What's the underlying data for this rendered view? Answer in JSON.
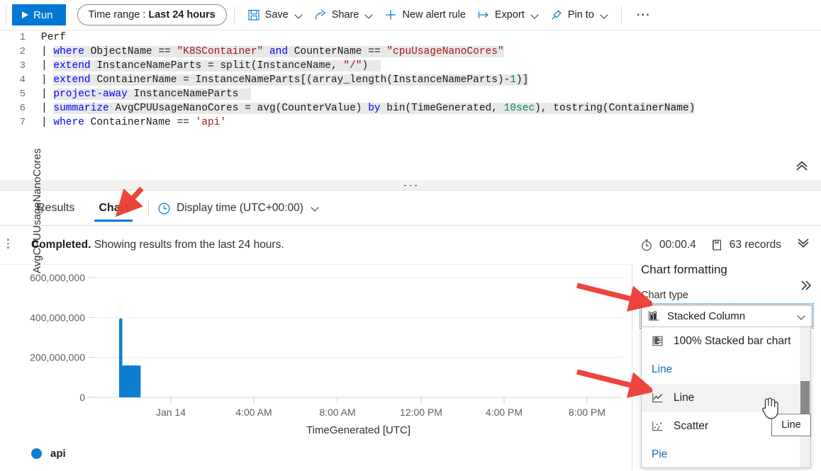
{
  "toolbar": {
    "run_label": "Run",
    "time_range_label": "Time range :",
    "time_range_value": "Last 24 hours",
    "save_label": "Save",
    "share_label": "Share",
    "new_alert_label": "New alert rule",
    "export_label": "Export",
    "pin_label": "Pin to",
    "more_label": "⋯",
    "accent": "#0078d4"
  },
  "editor": {
    "lines": [
      {
        "n": "1",
        "text": "Perf"
      },
      {
        "n": "2",
        "text": "| where ObjectName == \"K8SContainer\" and CounterName == \"cpuUsageNanoCores\""
      },
      {
        "n": "3",
        "text": "| extend InstanceNameParts = split(InstanceName, \"/\")"
      },
      {
        "n": "4",
        "text": "| extend ContainerName = InstanceNameParts[(array_length(InstanceNameParts)-1)]"
      },
      {
        "n": "5",
        "text": "| project-away InstanceNameParts"
      },
      {
        "n": "6",
        "text": "| summarize AvgCPUUsageNanoCores = avg(CounterValue) by bin(TimeGenerated, 10sec), tostring(ContainerName)"
      },
      {
        "n": "7",
        "text": "| where ContainerName == 'api'"
      }
    ],
    "collapse_icon": "chevron-double-up-icon"
  },
  "tabs": {
    "results_label": "Results",
    "chart_label": "Chart",
    "active": "Chart",
    "display_time_label": "Display time (UTC+00:00)"
  },
  "status": {
    "state": "Completed.",
    "message": " Showing results from the last 24 hours.",
    "duration": "00:00.4",
    "records": "63 records",
    "expand_icon": "chevron-double-down-icon"
  },
  "chart_data": {
    "type": "bar",
    "title": "",
    "xlabel": "TimeGenerated [UTC]",
    "ylabel": "AvgCPUUsageNanoCores",
    "ylim": [
      0,
      600000000
    ],
    "yticks": [
      "0",
      "200,000,000",
      "400,000,000",
      "600,000,000"
    ],
    "ytick_values": [
      0,
      200000000,
      400000000,
      600000000
    ],
    "xticks": [
      "Jan 14",
      "4:00 AM",
      "8:00 AM",
      "12:00 PM",
      "4:00 PM",
      "8:00 PM"
    ],
    "grid": true,
    "legend_position": "bottom-left",
    "series": [
      {
        "name": "api",
        "color": "#0f7ed0",
        "values": [
          393000000,
          396000000,
          394000000,
          160000000,
          158000000,
          161000000,
          160000000,
          159000000,
          160000000,
          161000000,
          160000000,
          158000000,
          160000000,
          161000000,
          159000000,
          160000000,
          160000000,
          161000000,
          158000000,
          160000000,
          159000000,
          160000000
        ]
      }
    ]
  },
  "legend": {
    "name": "api",
    "color": "#0f7ed0"
  },
  "formatting": {
    "panel_title": "Chart formatting",
    "collapse_icon": "chevron-double-right-icon",
    "chart_type_label": "Chart type",
    "chart_type_value": "Stacked Column",
    "chart_type_icon": "stacked-column-icon",
    "dropdown": [
      {
        "label": "100% Stacked bar chart",
        "type": "item",
        "icon": "stacked-bar-100-icon",
        "hover": false
      },
      {
        "label": "Line",
        "type": "group"
      },
      {
        "label": "Line",
        "type": "item",
        "icon": "line-chart-icon",
        "hover": true
      },
      {
        "label": "Scatter",
        "type": "item",
        "icon": "scatter-chart-icon",
        "hover": false
      },
      {
        "label": "Pie",
        "type": "group"
      }
    ],
    "tooltip": "Line"
  }
}
